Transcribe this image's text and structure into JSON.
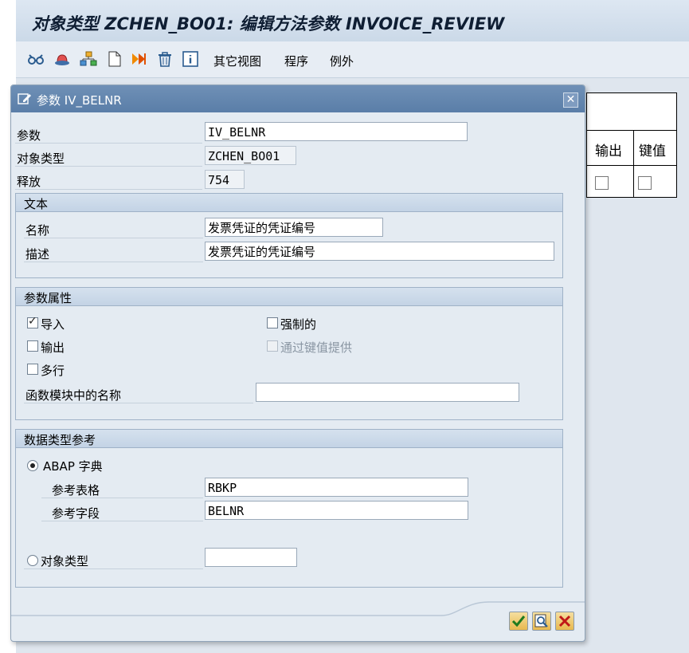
{
  "title": "对象类型 ZCHEN_BO01: 编辑方法参数 INVOICE_REVIEW",
  "toolbar": {
    "icons": [
      "glasses-icon",
      "hat-icon",
      "hierarchy-icon",
      "new-document-icon",
      "forward-icon",
      "delete-icon",
      "info-icon"
    ],
    "menu": [
      "其它视图",
      "程序",
      "例外"
    ]
  },
  "background_table": {
    "headers": [
      "输出",
      "键值"
    ]
  },
  "dialog": {
    "title": "参数 IV_BELNR",
    "param_label": "参数",
    "param_value": "IV_BELNR",
    "objtype_label": "对象类型",
    "objtype_value": "ZCHEN_BO01",
    "release_label": "释放",
    "release_value": "754",
    "text_group": {
      "header": "文本",
      "name_label": "名称",
      "name_value": "发票凭证的凭证编号",
      "desc_label": "描述",
      "desc_value": "发票凭证的凭证编号"
    },
    "attr_group": {
      "header": "参数属性",
      "import_label": "导入",
      "import_checked": true,
      "output_label": "输出",
      "output_checked": false,
      "multiline_label": "多行",
      "multiline_checked": false,
      "mandatory_label": "强制的",
      "mandatory_checked": false,
      "bykey_label": "通过键值提供",
      "bykey_checked": false,
      "fm_name_label": "函数模块中的名称",
      "fm_name_value": ""
    },
    "dtype_group": {
      "header": "数据类型参考",
      "abap_label": "ABAP 字典",
      "abap_selected": true,
      "table_label": "参考表格",
      "table_value": "RBKP",
      "field_label": "参考字段",
      "field_value": "BELNR",
      "objtype_label": "对象类型",
      "objtype_value": ""
    },
    "buttons": [
      "confirm-icon",
      "search-icon",
      "cancel-icon"
    ]
  }
}
